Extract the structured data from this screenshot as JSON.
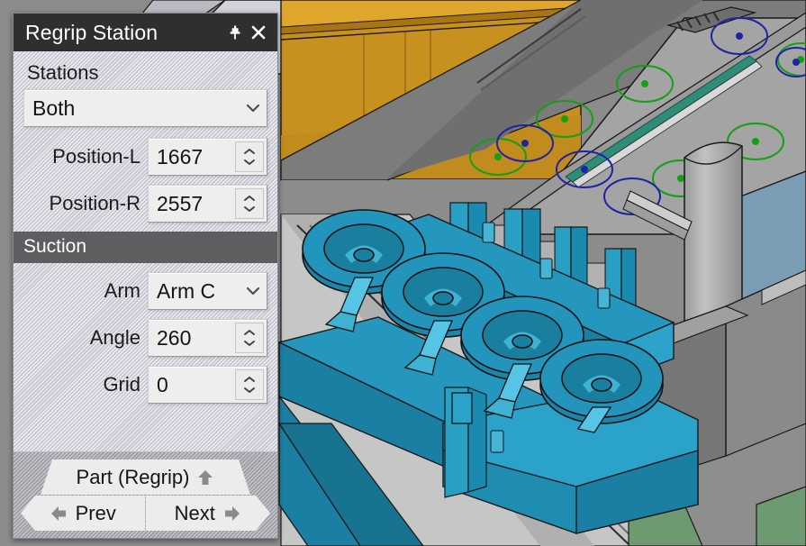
{
  "window": {
    "title": "Regrip Station",
    "pin_icon": "pin-icon",
    "close_icon": "close-icon"
  },
  "form": {
    "stations_label": "Stations",
    "stations_value": "Both",
    "stations_options": [
      "Both"
    ],
    "position_l_label": "Position-L",
    "position_l_value": "1667",
    "position_r_label": "Position-R",
    "position_r_value": "2557"
  },
  "suction": {
    "header": "Suction",
    "arm_label": "Arm",
    "arm_value": "Arm C",
    "arm_options": [
      "Arm C"
    ],
    "angle_label": "Angle",
    "angle_value": "260",
    "grid_label": "Grid",
    "grid_value": "0"
  },
  "nav": {
    "part_label": "Part (Regrip)",
    "part_icon": "arrow-up-icon",
    "prev_label": "Prev",
    "prev_icon": "arrow-left-icon",
    "next_label": "Next",
    "next_icon": "arrow-right-icon"
  },
  "colors": {
    "titlebar_bg": "#2f2f2f",
    "section_bg": "#5e5e61",
    "panel_bg": "#d7d7df",
    "field_bg": "#eeeeee",
    "scene_gray": "#8c8c8c",
    "scene_orange": "#c8901e",
    "scene_green": "#84b894",
    "scene_cyan": "#1c93bb",
    "scene_steelblue": "#7a9cb4",
    "marker_green": "#14a014",
    "marker_blue": "#2222a8"
  },
  "scene": {
    "description": "3D CAD view of regrip station: sheet-metal plate with green and blue suction-point markers, cyan suction-cup tooling bar, gray column, orange machine panel"
  }
}
